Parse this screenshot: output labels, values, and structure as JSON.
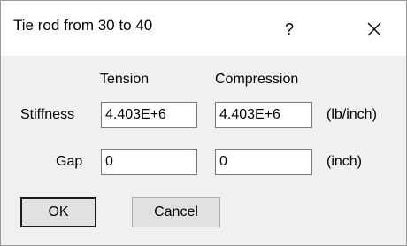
{
  "window": {
    "title": "Tie rod from 30 to 40",
    "help_glyph": "?",
    "close_icon": "close-icon"
  },
  "columns": {
    "tension": "Tension",
    "compression": "Compression"
  },
  "rows": {
    "stiffness": {
      "label": "Stiffness",
      "tension_value": "4.403E+6",
      "compression_value": "4.403E+6",
      "unit": "(lb/inch)"
    },
    "gap": {
      "label": "Gap",
      "tension_value": "0",
      "compression_value": "0",
      "unit": "(inch)"
    }
  },
  "buttons": {
    "ok": "OK",
    "cancel": "Cancel"
  }
}
